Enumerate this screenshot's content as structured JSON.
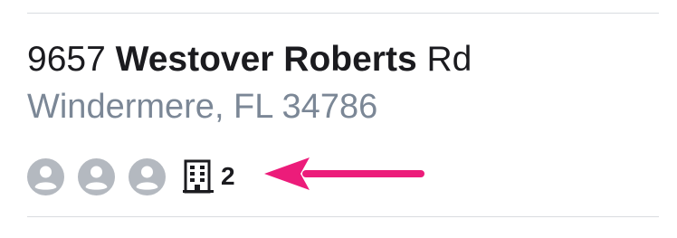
{
  "address": {
    "number": "9657",
    "name": "Westover Roberts",
    "suffix": "Rd",
    "city_line": "Windermere, FL 34786"
  },
  "meta": {
    "occupant_icons": [
      "person-icon",
      "person-icon",
      "person-icon"
    ],
    "building_icon": "building-icon",
    "unit_count": "2"
  },
  "annotation": {
    "arrow_color": "#ec1c7a"
  },
  "colors": {
    "primary_text": "#1b1b1f",
    "secondary_text": "#7b8796",
    "icon_gray": "#b4b9c0",
    "divider": "#d9dce0"
  }
}
